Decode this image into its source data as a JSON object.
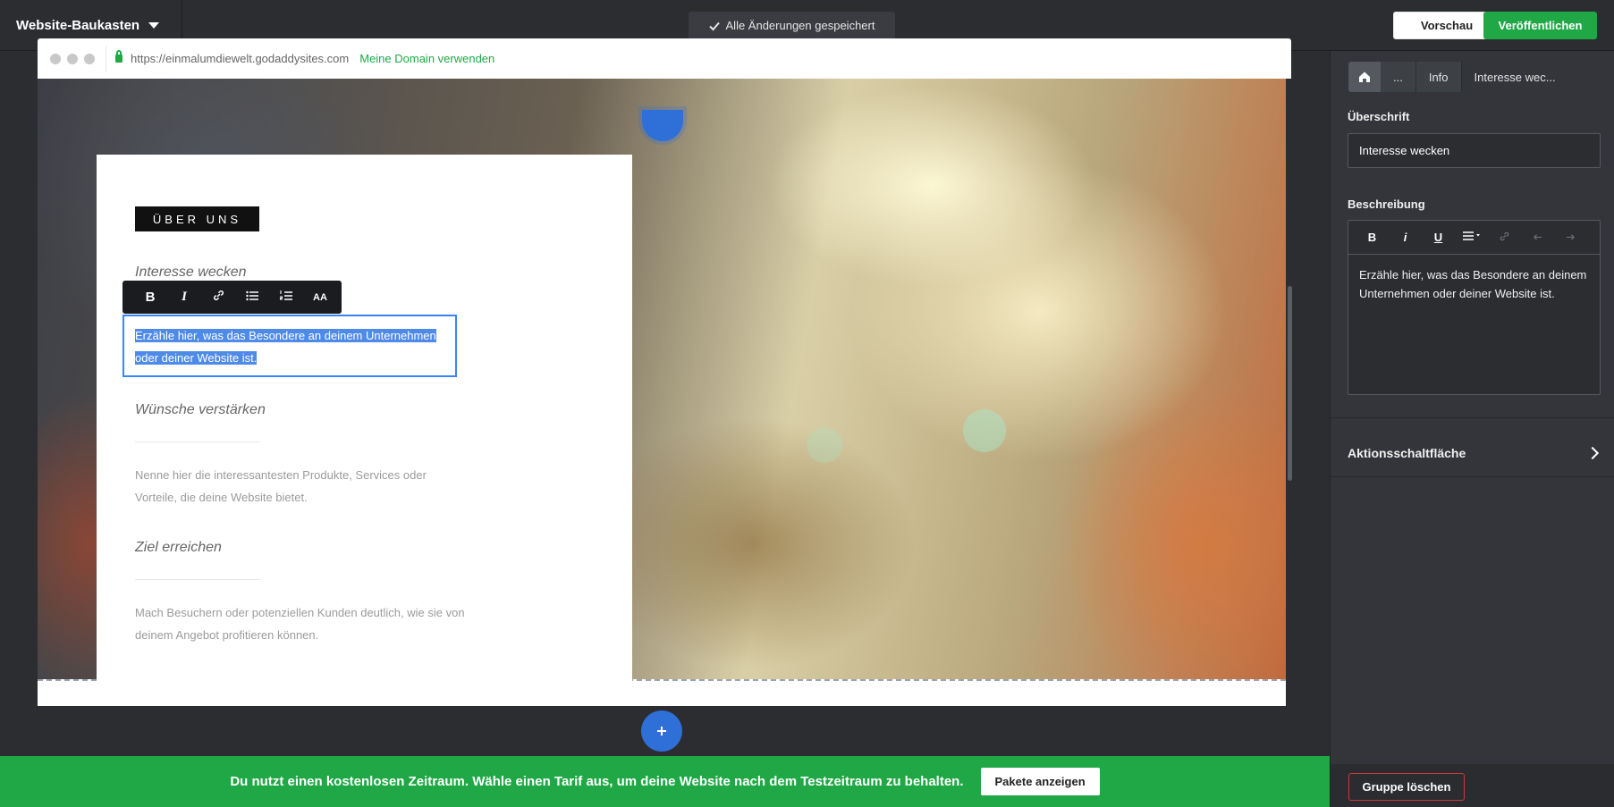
{
  "topbar": {
    "brand": "Website-Baukasten",
    "saved_status": "Alle Änderungen gespeichert",
    "preview_label": "Vorschau",
    "publish_label": "Veröffentlichen"
  },
  "browser": {
    "url": "https://einmalumdiewelt.godaddysites.com",
    "domain_link": "Meine Domain verwenden"
  },
  "section": {
    "eyebrow": "ÜBER UNS",
    "heading_interest": "Interesse wecken",
    "selected_text": "Erzähle hier, was das Besondere an deinem Unternehmen oder deiner Website ist.",
    "heading_wish": "Wünsche verstärken",
    "text_wish": "Nenne hier die interessantesten Produkte, Services oder Vorteile, die deine Website bietet.",
    "heading_goal": "Ziel erreichen",
    "text_goal": "Mach Besuchern oder potenziellen Kunden deutlich, wie sie von deinem Angebot profitieren können."
  },
  "rte_toolbar": {
    "bold": "B",
    "italic": "I",
    "case": "AA"
  },
  "trial": {
    "message": "Du nutzt einen kostenlosen Zeitraum. Wähle einen Tarif aus, um deine Website nach dem Testzeitraum zu behalten.",
    "button": "Pakete anzeigen"
  },
  "panel": {
    "breadcrumbs": [
      "...",
      "Info",
      "Interesse wec..."
    ],
    "heading_label": "Überschrift",
    "heading_value": "Interesse wecken",
    "description_label": "Beschreibung",
    "description_toolbar": {
      "bold": "B",
      "italic": "i",
      "underline": "U"
    },
    "description_value": "Erzähle hier, was das Besondere an deinem Unternehmen oder deiner Website ist.",
    "action_label": "Aktionsschaltfläche",
    "delete_group": "Gruppe löschen"
  },
  "colors": {
    "accent_green": "#1fa845",
    "selection_blue": "#3b83f6",
    "add_button_blue": "#2f6fd8"
  }
}
